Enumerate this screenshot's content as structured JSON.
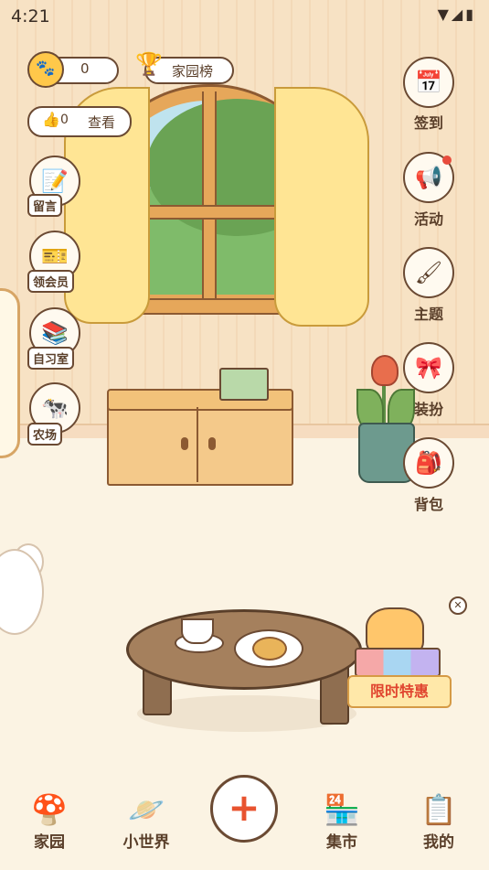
{
  "status_bar": {
    "time": "4:21",
    "icons": "▼◢▮"
  },
  "header": {
    "coins": "0",
    "rank_label": "家园榜",
    "likes": "0",
    "view_label": "查看"
  },
  "left_menu": [
    {
      "label": "留言",
      "icon": "message-board-icon"
    },
    {
      "label": "领会员",
      "icon": "vip-card-icon"
    },
    {
      "label": "自习室",
      "icon": "study-room-icon"
    },
    {
      "label": "农场",
      "icon": "farm-icon"
    }
  ],
  "right_menu": [
    {
      "label": "签到",
      "icon": "calendar-icon"
    },
    {
      "label": "活动",
      "icon": "megaphone-icon"
    },
    {
      "label": "主题",
      "icon": "paint-roller-icon"
    },
    {
      "label": "装扮",
      "icon": "bow-icon"
    },
    {
      "label": "背包",
      "icon": "backpack-icon"
    }
  ],
  "promo": {
    "label": "限时特惠"
  },
  "nav": {
    "home": "家园",
    "world": "小世界",
    "add": "+",
    "market": "集市",
    "mine": "我的"
  },
  "colors": {
    "accent": "#e8532f",
    "outline": "#6b4a33",
    "wall": "#f7e2c4"
  }
}
